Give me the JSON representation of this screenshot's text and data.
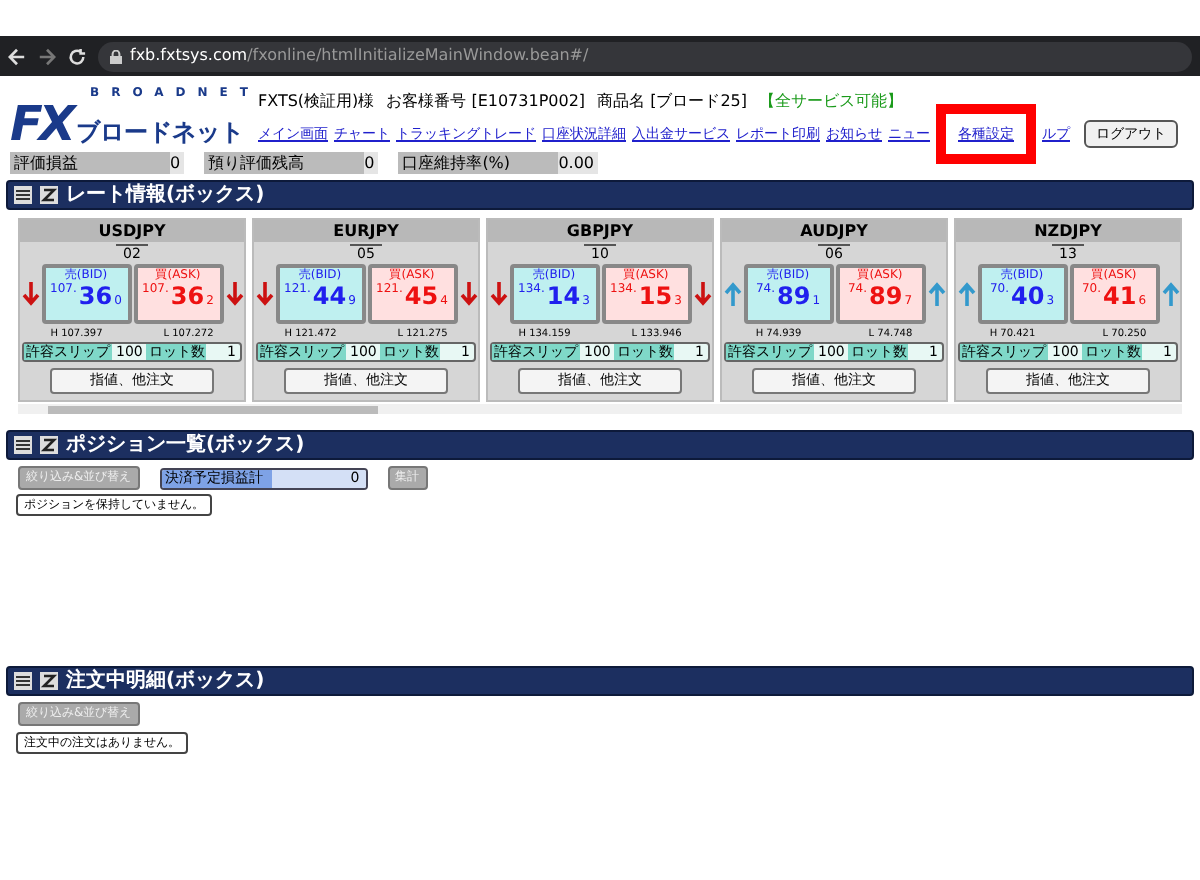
{
  "browser": {
    "url_host": "fxb.fxtsys.com",
    "url_path": "/fxonline/htmlInitializeMainWindow.bean#/"
  },
  "header": {
    "logo_top": "BROADNET",
    "logo_fx": "FX",
    "logo_name": "ブロードネット",
    "account": "FXTS(検証用)様",
    "customer_no": "お客様番号 [E10731P002]",
    "product": "商品名 [ブロード25]",
    "service": "【全サービス可能】",
    "nav": [
      {
        "label": "メイン画面",
        "highlighted": false
      },
      {
        "label": "チャート",
        "highlighted": false
      },
      {
        "label": "トラッキングトレード",
        "highlighted": false
      },
      {
        "label": "口座状況詳細",
        "highlighted": false
      },
      {
        "label": "入出金サービス",
        "highlighted": false
      },
      {
        "label": "レポート印刷",
        "highlighted": false
      },
      {
        "label": "お知らせ",
        "highlighted": false
      },
      {
        "label": "ニュー",
        "highlighted": false
      },
      {
        "label": "各種設定",
        "highlighted": true
      },
      {
        "label": "ルプ",
        "highlighted": false
      }
    ],
    "logout": "ログアウト",
    "stats": [
      {
        "label": "評価損益",
        "value": "0"
      },
      {
        "label": "預り評価残高",
        "value": "0"
      },
      {
        "label": "口座維持率(%)",
        "value": "0.00"
      }
    ]
  },
  "rate_panel": {
    "title": "レート情報(ボックス)",
    "cards": [
      {
        "pair": "USDJPY",
        "number": "02",
        "rising": false,
        "bid_label": "売(BID)",
        "bid": [
          "107.",
          "36",
          "0"
        ],
        "ask_label": "買(ASK)",
        "ask": [
          "107.",
          "36",
          "2"
        ],
        "high": "H 107.397",
        "low": "L 107.272",
        "slip_label": "許容スリップ",
        "slip": "100",
        "lot_label": "ロット数",
        "lot": "1",
        "button": "指値、他注文"
      },
      {
        "pair": "EURJPY",
        "number": "05",
        "rising": false,
        "bid_label": "売(BID)",
        "bid": [
          "121.",
          "44",
          "9"
        ],
        "ask_label": "買(ASK)",
        "ask": [
          "121.",
          "45",
          "4"
        ],
        "high": "H 121.472",
        "low": "L 121.275",
        "slip_label": "許容スリップ",
        "slip": "100",
        "lot_label": "ロット数",
        "lot": "1",
        "button": "指値、他注文"
      },
      {
        "pair": "GBPJPY",
        "number": "10",
        "rising": false,
        "bid_label": "売(BID)",
        "bid": [
          "134.",
          "14",
          "3"
        ],
        "ask_label": "買(ASK)",
        "ask": [
          "134.",
          "15",
          "3"
        ],
        "high": "H 134.159",
        "low": "L 133.946",
        "slip_label": "許容スリップ",
        "slip": "100",
        "lot_label": "ロット数",
        "lot": "1",
        "button": "指値、他注文"
      },
      {
        "pair": "AUDJPY",
        "number": "06",
        "rising": true,
        "bid_label": "売(BID)",
        "bid": [
          "74.",
          "89",
          "1"
        ],
        "ask_label": "買(ASK)",
        "ask": [
          "74.",
          "89",
          "7"
        ],
        "high": "H 74.939",
        "low": "L 74.748",
        "slip_label": "許容スリップ",
        "slip": "100",
        "lot_label": "ロット数",
        "lot": "1",
        "button": "指値、他注文"
      },
      {
        "pair": "NZDJPY",
        "number": "13",
        "rising": true,
        "bid_label": "売(BID)",
        "bid": [
          "70.",
          "40",
          "3"
        ],
        "ask_label": "買(ASK)",
        "ask": [
          "70.",
          "41",
          "6"
        ],
        "high": "H 70.421",
        "low": "L 70.250",
        "slip_label": "許容スリップ",
        "slip": "100",
        "lot_label": "ロット数",
        "lot": "1",
        "button": "指値、他注文"
      }
    ]
  },
  "position_panel": {
    "title": "ポジション一覧(ボックス)",
    "filter_button": "絞り込み&並び替え",
    "total_label": "決済予定損益計",
    "total_value": "0",
    "sum_button": "集計",
    "message": "ポジションを保持していません。"
  },
  "order_panel": {
    "title": "注文中明細(ボックス)",
    "filter_button": "絞り込み&並び替え",
    "message": "注文中の注文はありません。"
  }
}
